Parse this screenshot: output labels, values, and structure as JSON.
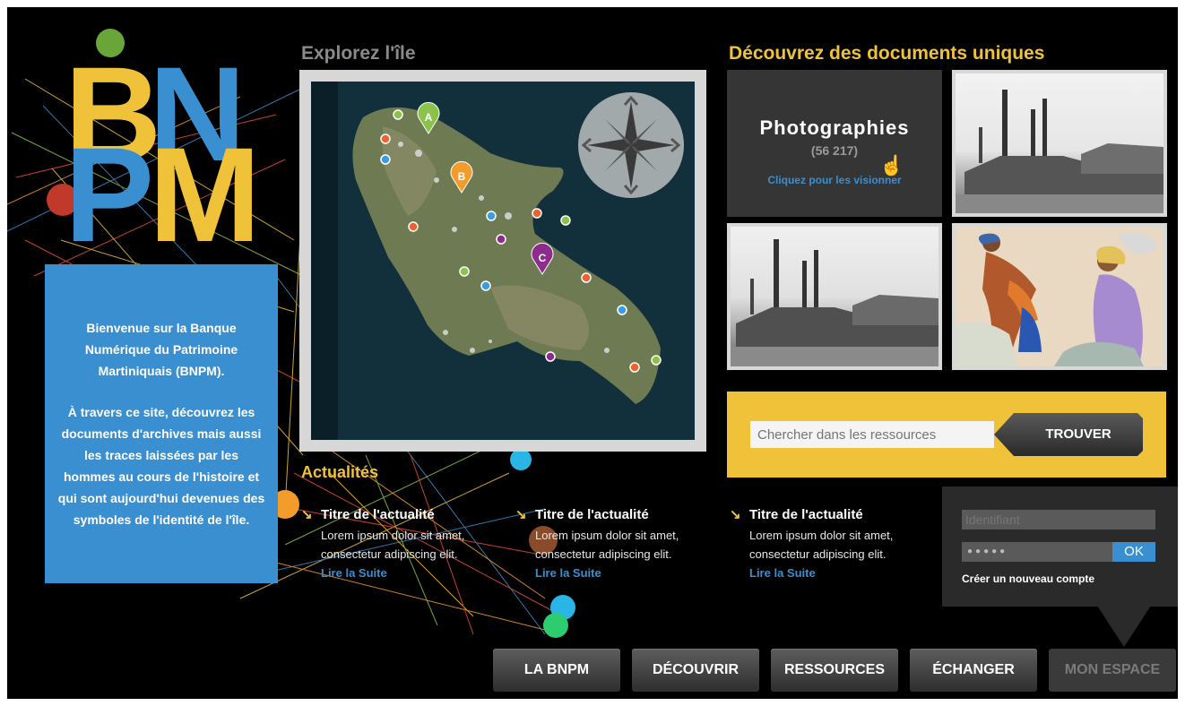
{
  "logo": {
    "text_line1": "BN",
    "text_line2": "PM"
  },
  "welcome": {
    "paragraph1": "Bienvenue sur la Banque Numérique du Patrimoine Martiniquais (BNPM).",
    "paragraph2": "À travers ce site, découvrez les documents d'archives mais aussi les traces laissées par les hommes au cours de l'histoire et qui sont aujourd'hui devenues des symboles de l'identité de l'île."
  },
  "explore": {
    "title": "Explorez l'île",
    "markers": [
      {
        "label": "A",
        "color": "#8bc34a"
      },
      {
        "label": "B",
        "color": "#f39c2c"
      },
      {
        "label": "C",
        "color": "#8e2c8e"
      }
    ],
    "compass_icon": "compass-rose-icon"
  },
  "discover": {
    "title": "Découvrez des documents uniques",
    "featured": {
      "heading": "Photographies",
      "count": "(56 217)",
      "cta": "Cliquez pour les visionner"
    },
    "tiles": [
      {
        "alt": "factory-photo-1"
      },
      {
        "alt": "factory-photo-2"
      },
      {
        "alt": "painting-women-laundry"
      }
    ]
  },
  "search": {
    "placeholder": "Chercher dans les ressources",
    "button": "TROUVER"
  },
  "news": {
    "title": "Actualités",
    "items": [
      {
        "title": "Titre de l'actualité",
        "body": "Lorem ipsum dolor sit amet, consectetur adipiscing elit.",
        "link": "Lire la Suite"
      },
      {
        "title": "Titre de l'actualité",
        "body": "Lorem ipsum dolor sit amet, consectetur adipiscing elit.",
        "link": "Lire la Suite"
      },
      {
        "title": "Titre de l'actualité",
        "body": "Lorem ipsum dolor sit amet, consectetur adipiscing elit.",
        "link": "Lire la Suite"
      }
    ]
  },
  "login": {
    "username_placeholder": "Identifiant",
    "password_value": "●●●●●",
    "ok": "OK",
    "create_account": "Créer un nouveau compte"
  },
  "nav": {
    "items": [
      "LA BNPM",
      "DÉCOUVRIR",
      "RESSOURCES",
      "ÉCHANGER",
      "MON ESPACE"
    ]
  },
  "colors": {
    "yellow": "#f0c23a",
    "blue": "#3a8fd0",
    "background": "#000000"
  }
}
